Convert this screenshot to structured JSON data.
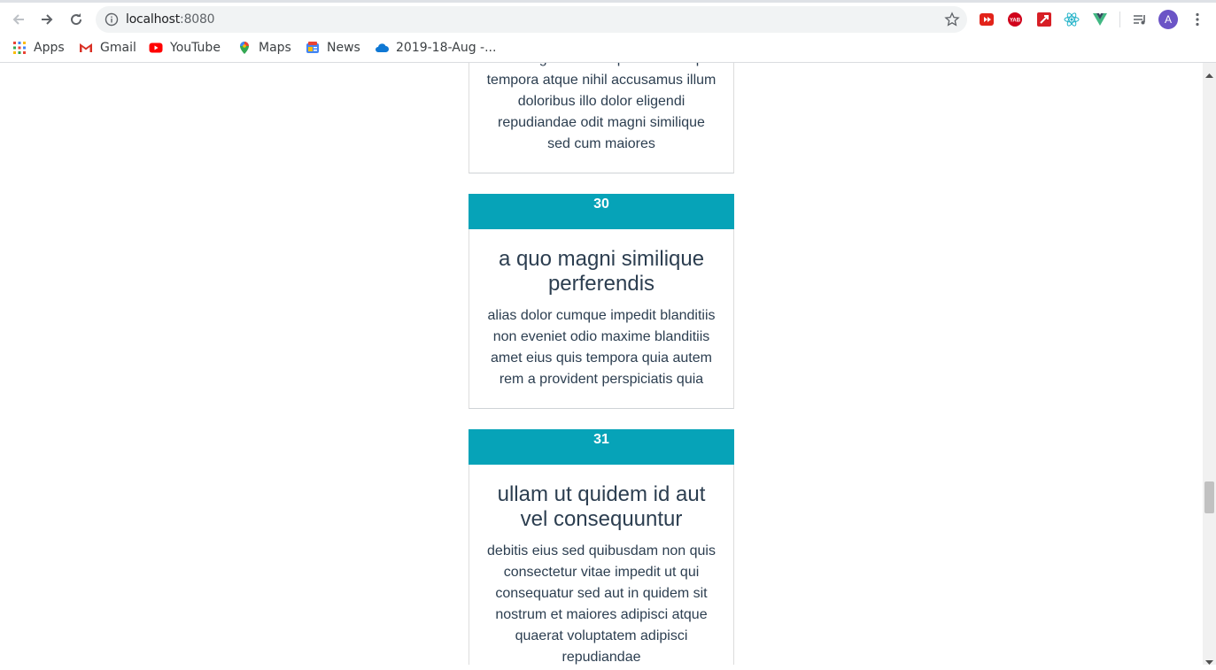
{
  "browser": {
    "url_host": "localhost",
    "url_port": ":8080",
    "avatar_letter": "A",
    "bookmarks": [
      {
        "label": "Apps",
        "icon": "apps-grid-icon"
      },
      {
        "label": "Gmail",
        "icon": "gmail-icon"
      },
      {
        "label": "YouTube",
        "icon": "youtube-icon"
      },
      {
        "label": "Maps",
        "icon": "maps-pin-icon"
      },
      {
        "label": "News",
        "icon": "news-icon"
      },
      {
        "label": "2019-18-Aug -...",
        "icon": "onedrive-cloud-icon"
      }
    ],
    "extensions": [
      "yt-extension-icon",
      "yab-extension-icon",
      "pdf-extension-icon",
      "react-devtools-icon",
      "vue-devtools-icon",
      "media-queue-icon"
    ]
  },
  "cards": [
    {
      "number": "",
      "title": "",
      "body": "odit magnam ut saepe sed non qui tempora atque nihil accusamus illum doloribus illo dolor eligendi repudiandae odit magni similique sed cum maiores"
    },
    {
      "number": "30",
      "title": "a quo magni similique perferendis",
      "body": "alias dolor cumque impedit blanditiis non eveniet odio maxime blanditiis amet eius quis tempora quia autem rem a provident perspiciatis quia"
    },
    {
      "number": "31",
      "title": "ullam ut quidem id aut vel consequuntur",
      "body": "debitis eius sed quibusdam non quis consectetur vitae impedit ut qui consequatur sed aut in quidem sit nostrum et maiores adipisci atque quaerat voluptatem adipisci repudiandae"
    }
  ],
  "colors": {
    "card_header": "#06a3b8",
    "text": "#2c3e50"
  }
}
